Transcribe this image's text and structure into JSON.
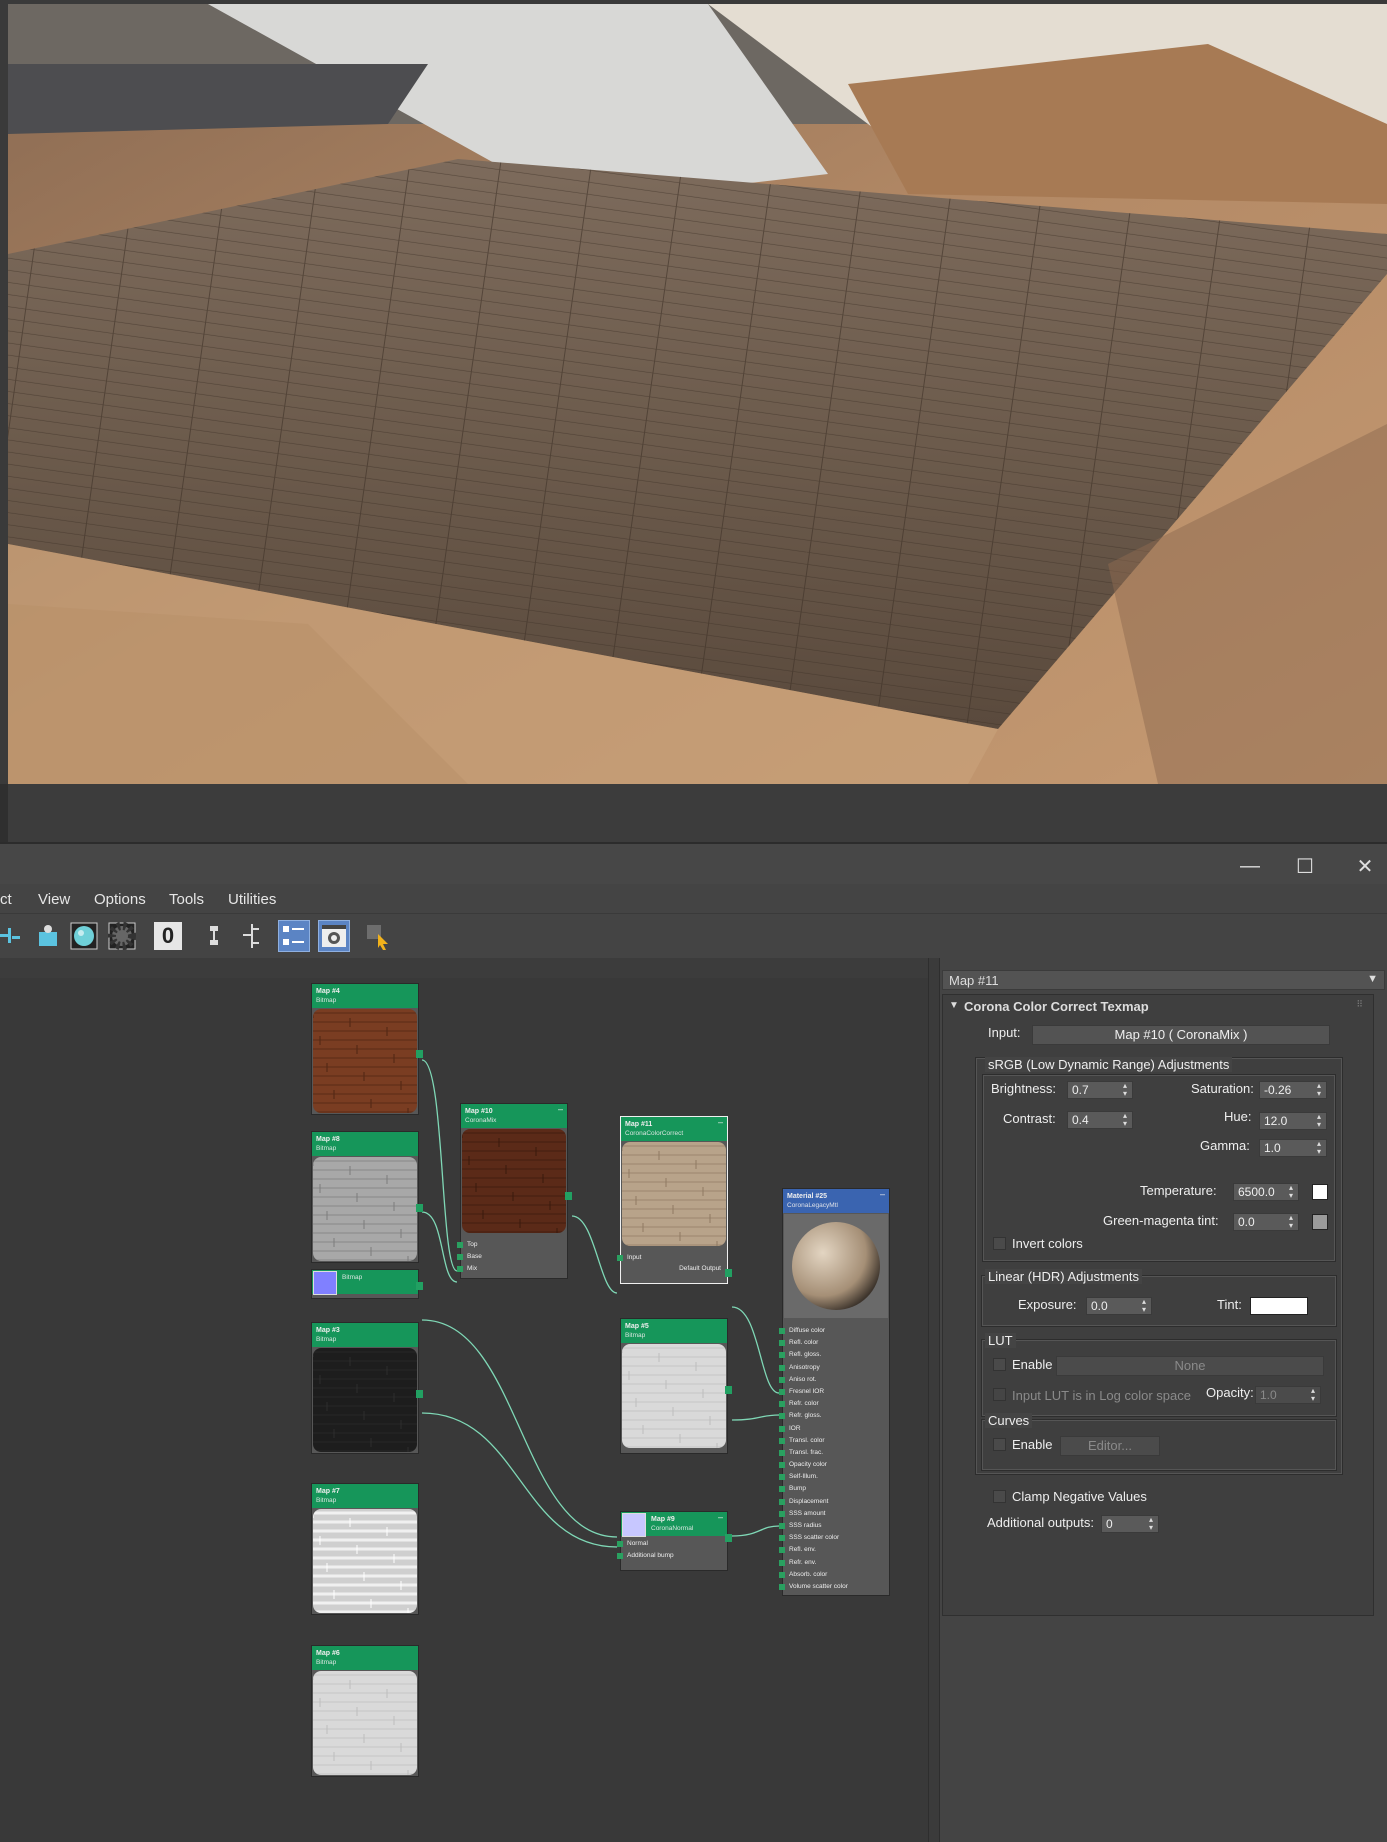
{
  "window": {
    "minimize_glyph": "—",
    "maximize_glyph": "☐",
    "close_glyph": "✕"
  },
  "menu": {
    "items": [
      "ct",
      "View",
      "Options",
      "Tools",
      "Utilities"
    ]
  },
  "toolbar": {
    "zero_label": "0"
  },
  "nodes": {
    "map4": {
      "title": "Map #4",
      "type": "Bitmap"
    },
    "map8": {
      "title": "Map #8",
      "type": "Bitmap"
    },
    "bitmap_small": {
      "type": "Bitmap"
    },
    "map3": {
      "title": "Map #3",
      "type": "Bitmap"
    },
    "map7": {
      "title": "Map #7",
      "type": "Bitmap"
    },
    "map6": {
      "title": "Map #6",
      "type": "Bitmap"
    },
    "map10": {
      "title": "Map #10",
      "type": "CoronaMix",
      "ports": [
        "Top",
        "Base",
        "Mix"
      ]
    },
    "map11": {
      "title": "Map #11",
      "type": "CoronaColorCorrect",
      "input": "Input",
      "output": "Default Output"
    },
    "map5": {
      "title": "Map #5",
      "type": "Bitmap"
    },
    "map9": {
      "title": "Map #9",
      "type": "CoronaNormal",
      "ports": [
        "Normal",
        "Additional bump"
      ]
    },
    "material25": {
      "title": "Material #25",
      "type": "CoronaLegacyMtl",
      "ports": [
        "Diffuse color",
        "Refl. color",
        "Refl. gloss.",
        "Anisotropy",
        "Aniso rot.",
        "Fresnel IOR",
        "Refr. color",
        "Refr. gloss.",
        "IOR",
        "Transl. color",
        "Transl. frac.",
        "Opacity color",
        "Self-Illum.",
        "Bump",
        "Displacement",
        "SSS amount",
        "SSS radius",
        "SSS scatter color",
        "Refl. env.",
        "Refr. env.",
        "Absorb. color",
        "Volume scatter color"
      ]
    }
  },
  "panel": {
    "header": "Map #11",
    "rollout_title": "Corona Color Correct Texmap",
    "input_label": "Input:",
    "input_value": "Map #10  ( CoronaMix )",
    "srgb": {
      "title": "sRGB (Low Dynamic Range) Adjustments",
      "brightness_label": "Brightness:",
      "brightness": "0.7",
      "saturation_label": "Saturation:",
      "saturation": "-0.26",
      "contrast_label": "Contrast:",
      "contrast": "0.4",
      "hue_label": "Hue:",
      "hue": "12.0",
      "gamma_label": "Gamma:",
      "gamma": "1.0",
      "temperature_label": "Temperature:",
      "temperature": "6500.0",
      "tint_label": "Green-magenta tint:",
      "tint": "0.0",
      "invert_label": "Invert colors"
    },
    "linear": {
      "title": "Linear (HDR) Adjustments",
      "exposure_label": "Exposure:",
      "exposure": "0.0",
      "tint_label": "Tint:"
    },
    "lut": {
      "title": "LUT",
      "enable_label": "Enable",
      "file_button": "None",
      "log_label": "Input LUT is in Log color space",
      "opacity_label": "Opacity:",
      "opacity": "1.0"
    },
    "curves": {
      "title": "Curves",
      "enable_label": "Enable",
      "editor_button": "Editor..."
    },
    "clamp_label": "Clamp Negative Values",
    "outputs_label": "Additional outputs:",
    "outputs": "0"
  },
  "colors": {
    "node_header": "#16965a",
    "material_header": "#3a64b0",
    "wire": "#7fd8b6"
  }
}
